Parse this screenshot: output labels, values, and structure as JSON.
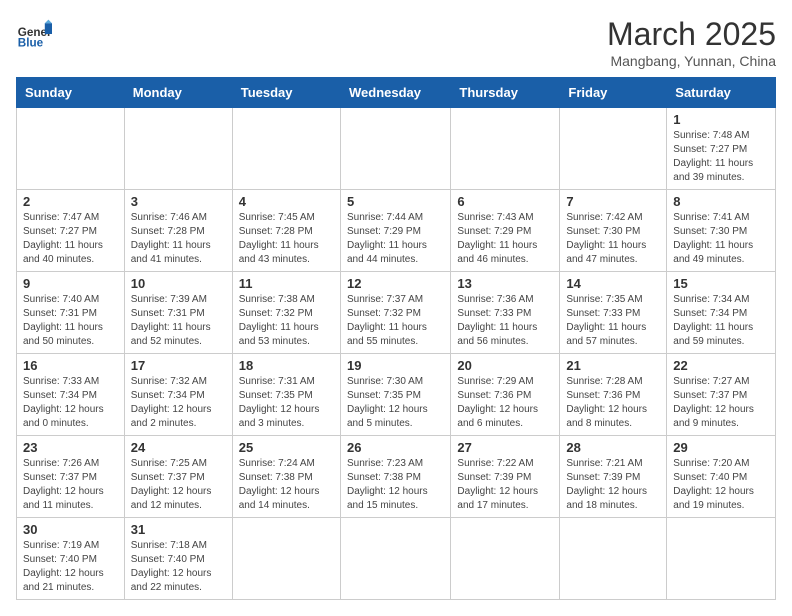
{
  "header": {
    "logo_general": "General",
    "logo_blue": "Blue",
    "month_title": "March 2025",
    "location": "Mangbang, Yunnan, China"
  },
  "weekdays": [
    "Sunday",
    "Monday",
    "Tuesday",
    "Wednesday",
    "Thursday",
    "Friday",
    "Saturday"
  ],
  "days": {
    "1": {
      "sunrise": "7:48 AM",
      "sunset": "7:27 PM",
      "daylight": "11 hours and 39 minutes."
    },
    "2": {
      "sunrise": "7:47 AM",
      "sunset": "7:27 PM",
      "daylight": "11 hours and 40 minutes."
    },
    "3": {
      "sunrise": "7:46 AM",
      "sunset": "7:28 PM",
      "daylight": "11 hours and 41 minutes."
    },
    "4": {
      "sunrise": "7:45 AM",
      "sunset": "7:28 PM",
      "daylight": "11 hours and 43 minutes."
    },
    "5": {
      "sunrise": "7:44 AM",
      "sunset": "7:29 PM",
      "daylight": "11 hours and 44 minutes."
    },
    "6": {
      "sunrise": "7:43 AM",
      "sunset": "7:29 PM",
      "daylight": "11 hours and 46 minutes."
    },
    "7": {
      "sunrise": "7:42 AM",
      "sunset": "7:30 PM",
      "daylight": "11 hours and 47 minutes."
    },
    "8": {
      "sunrise": "7:41 AM",
      "sunset": "7:30 PM",
      "daylight": "11 hours and 49 minutes."
    },
    "9": {
      "sunrise": "7:40 AM",
      "sunset": "7:31 PM",
      "daylight": "11 hours and 50 minutes."
    },
    "10": {
      "sunrise": "7:39 AM",
      "sunset": "7:31 PM",
      "daylight": "11 hours and 52 minutes."
    },
    "11": {
      "sunrise": "7:38 AM",
      "sunset": "7:32 PM",
      "daylight": "11 hours and 53 minutes."
    },
    "12": {
      "sunrise": "7:37 AM",
      "sunset": "7:32 PM",
      "daylight": "11 hours and 55 minutes."
    },
    "13": {
      "sunrise": "7:36 AM",
      "sunset": "7:33 PM",
      "daylight": "11 hours and 56 minutes."
    },
    "14": {
      "sunrise": "7:35 AM",
      "sunset": "7:33 PM",
      "daylight": "11 hours and 57 minutes."
    },
    "15": {
      "sunrise": "7:34 AM",
      "sunset": "7:34 PM",
      "daylight": "11 hours and 59 minutes."
    },
    "16": {
      "sunrise": "7:33 AM",
      "sunset": "7:34 PM",
      "daylight": "12 hours and 0 minutes."
    },
    "17": {
      "sunrise": "7:32 AM",
      "sunset": "7:34 PM",
      "daylight": "12 hours and 2 minutes."
    },
    "18": {
      "sunrise": "7:31 AM",
      "sunset": "7:35 PM",
      "daylight": "12 hours and 3 minutes."
    },
    "19": {
      "sunrise": "7:30 AM",
      "sunset": "7:35 PM",
      "daylight": "12 hours and 5 minutes."
    },
    "20": {
      "sunrise": "7:29 AM",
      "sunset": "7:36 PM",
      "daylight": "12 hours and 6 minutes."
    },
    "21": {
      "sunrise": "7:28 AM",
      "sunset": "7:36 PM",
      "daylight": "12 hours and 8 minutes."
    },
    "22": {
      "sunrise": "7:27 AM",
      "sunset": "7:37 PM",
      "daylight": "12 hours and 9 minutes."
    },
    "23": {
      "sunrise": "7:26 AM",
      "sunset": "7:37 PM",
      "daylight": "12 hours and 11 minutes."
    },
    "24": {
      "sunrise": "7:25 AM",
      "sunset": "7:37 PM",
      "daylight": "12 hours and 12 minutes."
    },
    "25": {
      "sunrise": "7:24 AM",
      "sunset": "7:38 PM",
      "daylight": "12 hours and 14 minutes."
    },
    "26": {
      "sunrise": "7:23 AM",
      "sunset": "7:38 PM",
      "daylight": "12 hours and 15 minutes."
    },
    "27": {
      "sunrise": "7:22 AM",
      "sunset": "7:39 PM",
      "daylight": "12 hours and 17 minutes."
    },
    "28": {
      "sunrise": "7:21 AM",
      "sunset": "7:39 PM",
      "daylight": "12 hours and 18 minutes."
    },
    "29": {
      "sunrise": "7:20 AM",
      "sunset": "7:40 PM",
      "daylight": "12 hours and 19 minutes."
    },
    "30": {
      "sunrise": "7:19 AM",
      "sunset": "7:40 PM",
      "daylight": "12 hours and 21 minutes."
    },
    "31": {
      "sunrise": "7:18 AM",
      "sunset": "7:40 PM",
      "daylight": "12 hours and 22 minutes."
    }
  }
}
